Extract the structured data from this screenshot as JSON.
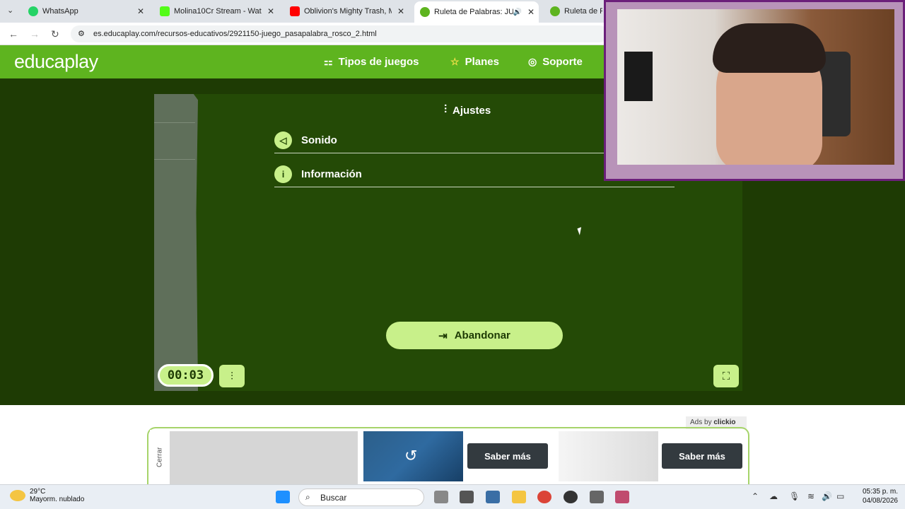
{
  "browser": {
    "tabs": [
      {
        "title": "WhatsApp",
        "color": "#25d366"
      },
      {
        "title": "Molina10Cr Stream - Watch",
        "color": "#53fc18"
      },
      {
        "title": "Oblivion's Mighty Trash, Ma",
        "color": "#ff0000"
      },
      {
        "title": "Ruleta de Palabras: JUEG",
        "color": "#5eb41f",
        "active": true
      },
      {
        "title": "Ruleta de Pa",
        "color": "#5eb41f"
      }
    ],
    "url": "es.educaplay.com/recursos-educativos/2921150-juego_pasapalabra_rosco_2.html"
  },
  "header": {
    "logo": "educaplay",
    "nav": [
      {
        "label": "Tipos de juegos",
        "icon": "games-icon"
      },
      {
        "label": "Planes",
        "icon": "star-icon"
      },
      {
        "label": "Soporte",
        "icon": "lifebuoy-icon"
      }
    ]
  },
  "settings": {
    "title": "Ajustes",
    "rows": [
      {
        "label": "Sonido",
        "icon": "speaker-icon"
      },
      {
        "label": "Información",
        "icon": "info-icon"
      }
    ],
    "abandon_label": "Abandonar",
    "timer": "00:03"
  },
  "ads": {
    "ads_by": "Ads by",
    "ads_brand": "clickio",
    "close_label": "Cerrar",
    "cta1": "Saber más",
    "cta2": "Saber más"
  },
  "taskbar": {
    "temp": "29°C",
    "weather": "Mayorm. nublado",
    "search": "Buscar",
    "time": "05:35 p. m.",
    "date": "04/08/2026"
  },
  "colors": {
    "brand": "#5eb41f",
    "accent": "#c8f08a",
    "panel": "#244a06"
  }
}
